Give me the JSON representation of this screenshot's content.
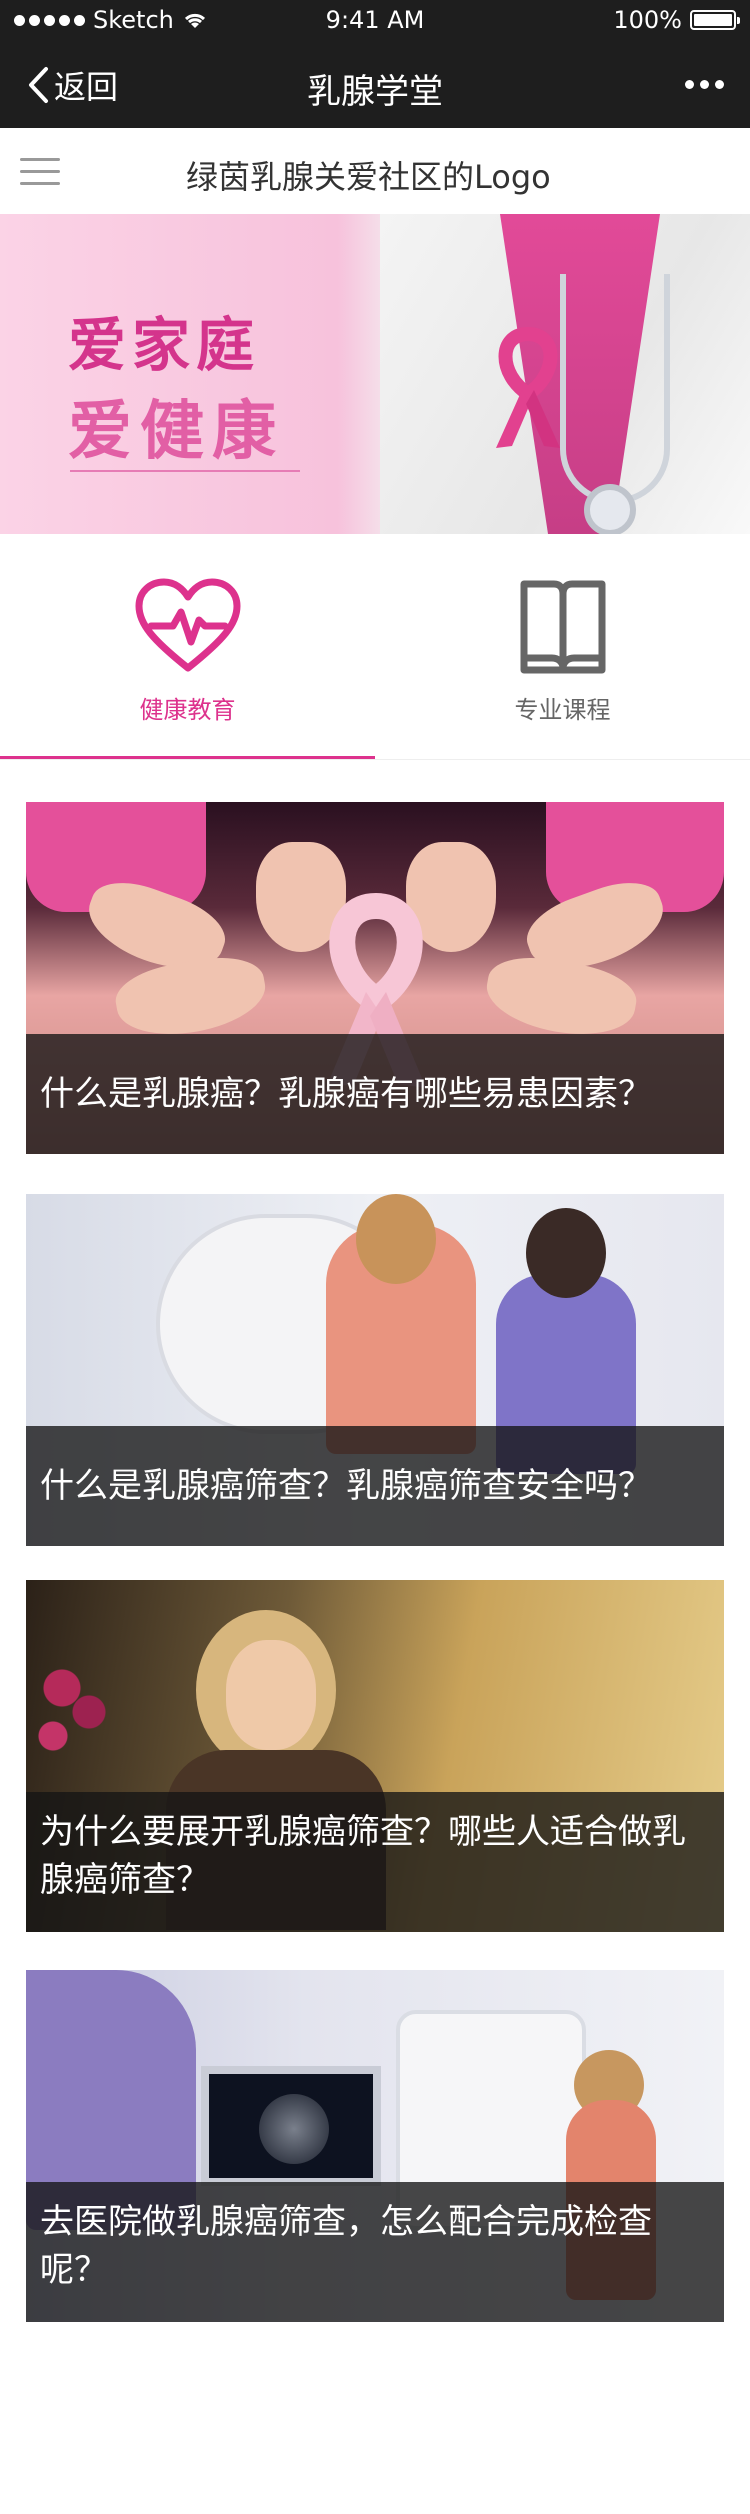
{
  "status_bar": {
    "carrier": "Sketch",
    "time": "9:41 AM",
    "battery": "100%"
  },
  "nav": {
    "back_label": "返回",
    "title": "乳腺学堂"
  },
  "header": {
    "logo_text": "绿茵乳腺关爱社区的Logo"
  },
  "hero": {
    "line1": "爱家庭",
    "line2": "爱健康"
  },
  "tabs": [
    {
      "label": "健康教育",
      "icon": "heartbeat-icon",
      "active": true
    },
    {
      "label": "专业课程",
      "icon": "book-icon",
      "active": false
    }
  ],
  "articles": [
    {
      "title": "什么是乳腺癌？乳腺癌有哪些易患因素？"
    },
    {
      "title": "什么是乳腺癌筛查？乳腺癌筛查安全吗？"
    },
    {
      "title": "为什么要展开乳腺癌筛查？哪些人适合做乳腺癌筛查？"
    },
    {
      "title": "去医院做乳腺癌筛查，怎么配合完成检查呢？"
    }
  ],
  "colors": {
    "accent": "#dd328d",
    "text_primary": "#333333",
    "text_secondary": "#666666",
    "nav_bg": "#1e1e1e"
  }
}
